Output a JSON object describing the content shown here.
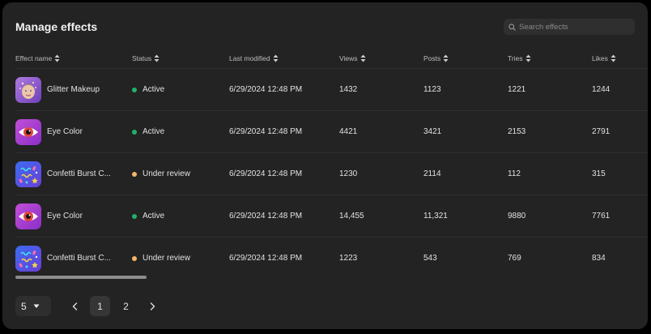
{
  "page": {
    "title": "Manage effects",
    "search_placeholder": "Search effects"
  },
  "colors": {
    "active": "#1fb26a",
    "under_review": "#f5b56a"
  },
  "table": {
    "columns": [
      "Effect name",
      "Status",
      "Last modified",
      "Views",
      "Posts",
      "Tries",
      "Likes"
    ],
    "rows": [
      {
        "icon": "glitter-makeup-icon",
        "name": "Glitter Makeup",
        "status": "Active",
        "status_color": "#1fb26a",
        "modified": "6/29/2024 12:48 PM",
        "views": "1432",
        "posts": "1123",
        "tries": "1221",
        "likes": "1244"
      },
      {
        "icon": "eye-color-icon",
        "name": "Eye Color",
        "status": "Active",
        "status_color": "#1fb26a",
        "modified": "6/29/2024 12:48 PM",
        "views": "4421",
        "posts": "3421",
        "tries": "2153",
        "likes": "2791"
      },
      {
        "icon": "confetti-burst-icon",
        "name": "Confetti Burst C...",
        "status": "Under review",
        "status_color": "#f5b56a",
        "modified": "6/29/2024 12:48 PM",
        "views": "1230",
        "posts": "2114",
        "tries": "112",
        "likes": "315"
      },
      {
        "icon": "eye-color-icon",
        "name": "Eye Color",
        "status": "Active",
        "status_color": "#1fb26a",
        "modified": "6/29/2024 12:48 PM",
        "views": "14,455",
        "posts": "11,321",
        "tries": "9880",
        "likes": "7761"
      },
      {
        "icon": "confetti-burst-icon",
        "name": "Confetti Burst C...",
        "status": "Under review",
        "status_color": "#f5b56a",
        "modified": "6/29/2024 12:48 PM",
        "views": "1223",
        "posts": "543",
        "tries": "769",
        "likes": "834"
      }
    ]
  },
  "pagination": {
    "per_page": "5",
    "pages": [
      "1",
      "2"
    ],
    "current_page": "1"
  }
}
